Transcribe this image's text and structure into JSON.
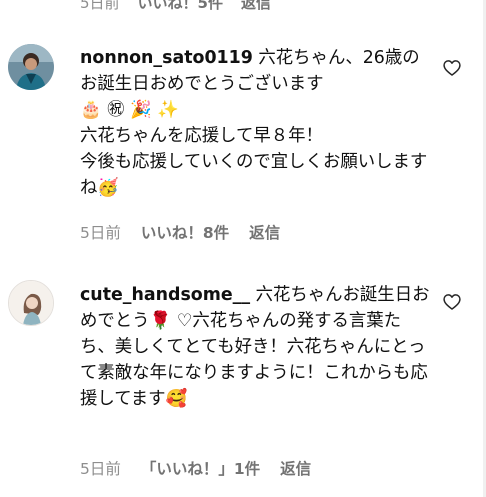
{
  "previous_comment": {
    "time": "5日前",
    "likes": "いいね！5件",
    "reply": "返信"
  },
  "comments": [
    {
      "username": "nonnon_sato0119",
      "text": " 六花ちゃん、26歳のお誕生日おめでとうございます\n🎂 ㊗ 🎉 ✨\n六花ちゃんを応援して早８年！\n今後も応援していくので宜しくお願いしますね🥳",
      "time": "5日前",
      "likes": "いいね！8件",
      "reply": "返信"
    },
    {
      "username": "cute_handsome__",
      "text": " 六花ちゃんお誕生日おめでとう🌹 ♡六花ちゃんの発する言葉たち、美しくてとても好き！六花ちゃんにとって素敵な年になりますように！これからも応援してます🥰",
      "time": "5日前",
      "likes": "「いいね！」1件",
      "reply": "返信"
    }
  ],
  "colors": {
    "text": "#111111",
    "meta": "#737373",
    "background": "#ffffff"
  }
}
